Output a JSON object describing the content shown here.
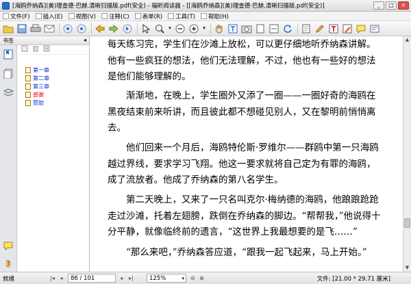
{
  "window": {
    "title": "[海鸥乔纳森](美)理查德·巴赫.清晰扫描版.pdf(安全) - 福昕阅读器 - [[海鸥乔纳森](美)理查德·巴赫.清晰扫描版.pdf(安全)]",
    "controls": [
      "_",
      "□",
      "×"
    ]
  },
  "menu": [
    {
      "label": "文件(F)"
    },
    {
      "label": "插入(E)"
    },
    {
      "label": "视图(V)"
    },
    {
      "label": "注释(C)"
    },
    {
      "label": "表单(R)"
    },
    {
      "label": "工具(T)"
    },
    {
      "label": "帮助(H)"
    }
  ],
  "sidebar": {
    "title": "书签",
    "collapse_glyph": "◂",
    "bookmarks": [
      {
        "label": "第一章",
        "color": "#0b2fd6"
      },
      {
        "label": "第二章",
        "color": "#0b2fd6"
      },
      {
        "label": "第三章",
        "color": "#0b2fd6"
      },
      {
        "label": "感谢",
        "color": "#e00000"
      },
      {
        "label": "赞助",
        "color": "#0b2fd6"
      }
    ]
  },
  "document": {
    "paragraphs": [
      "每天练习完，学生们在沙滩上放松，可以更仔细地听乔纳森讲解。他有一些疯狂的想法，他们无法理解，不过，他也有一些好的想法是他们能够理解的。",
      "渐渐地，在晚上，学生圈外又添了一圈——一圈好奇的海鸥在黑夜结束前来听讲，而且彼此都不想碰见别人，又在黎明前悄悄离去。",
      "他们回来一个月后，海鸥特伦斯·罗维尔——群鸥中第一只海鸥越过界线，要求学习飞翔。他这一要求就将自己定为有罪的海鸥，成了流放者。他成了乔纳森的第八名学生。",
      "第二天晚上，又来了一只名叫克尔·梅纳德的海鸥，他踉踉跄跄走过沙滩，托着左翅膀，跌倒在乔纳森的脚边。“帮帮我，”他说得十分平静，就像临终前的遗言，“这世界上我最想要的是飞……”",
      "“那么来吧，”乔纳森答应道，“跟我一起飞起来，马上开始。”"
    ]
  },
  "status": {
    "ready": "就绪",
    "page_current": "86",
    "page_total": "/ 101",
    "zoom": "125%",
    "file_size": "文件: [21.00 * 29.71 厘米]"
  },
  "colors": {
    "bookmark_blue": "#0b2fd6",
    "bookmark_red": "#e00000",
    "toolbar_accent": "#2a6bd0"
  },
  "toolbar_icons": [
    "open-folder-icon",
    "save-icon",
    "print-icon",
    "email-icon",
    "first-page-icon",
    "prev-page-icon",
    "next-page-icon",
    "back-icon",
    "forward-icon",
    "cursor-icon",
    "zoom-in-icon",
    "zoom-dropdown-icon",
    "zoom-out-icon",
    "zoom-plus-icon",
    "hand-tool-icon",
    "text-select-icon",
    "snapshot-icon",
    "fit-page-icon",
    "fit-width-icon",
    "rotate-icon",
    "bookmark-icon",
    "edit-icon",
    "typewriter-icon",
    "highlight-icon",
    "comment-icon",
    "form-icon"
  ]
}
